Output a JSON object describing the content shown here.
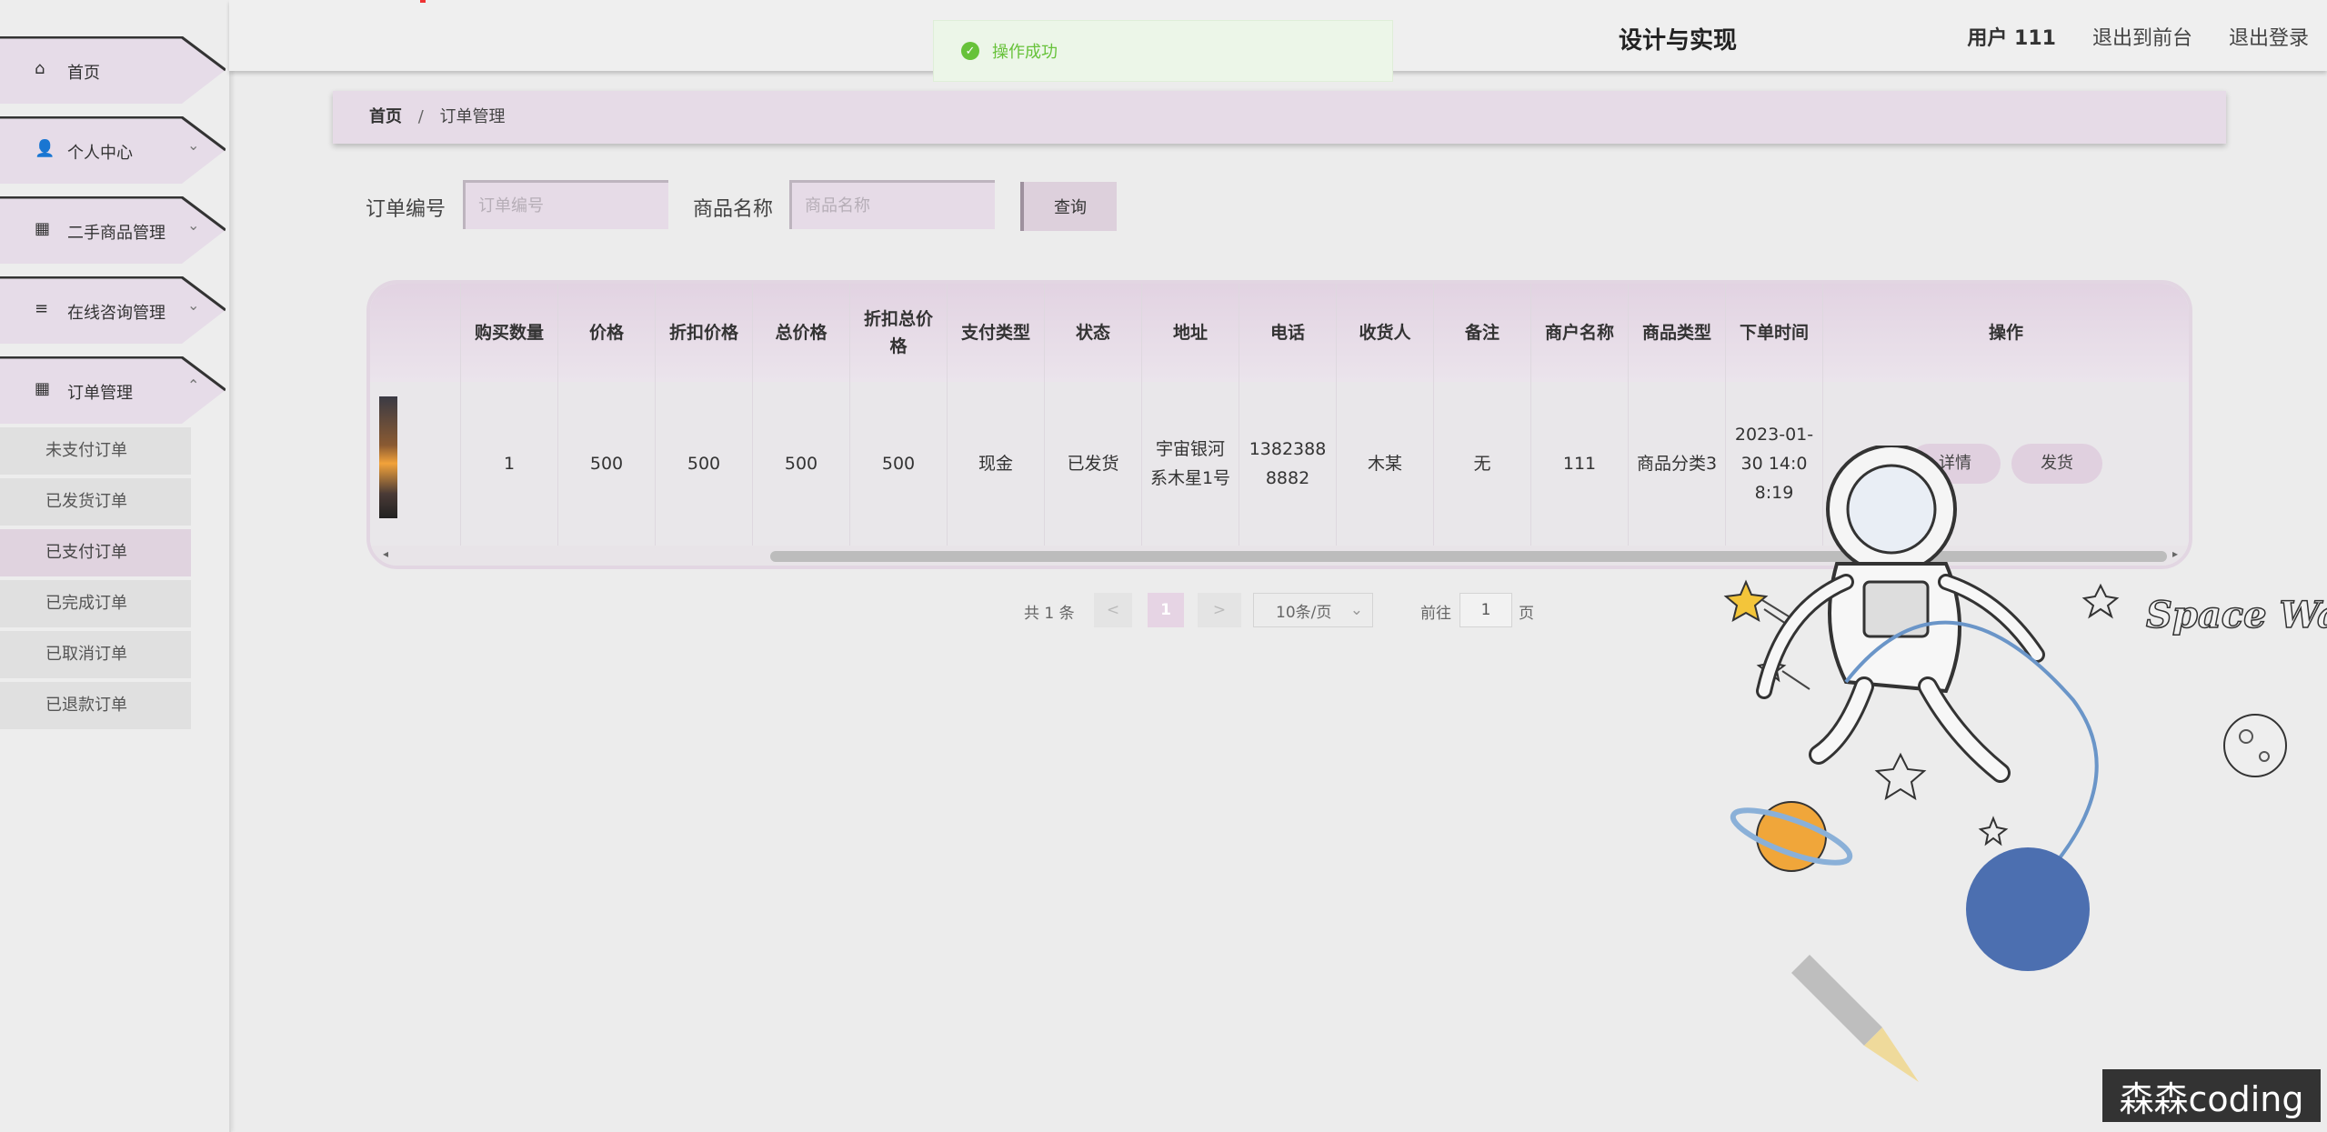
{
  "header": {
    "title_fragment": "设计与实现",
    "user": "用户 111",
    "to_front": "退出到前台",
    "logout": "退出登录"
  },
  "toast": {
    "message": "操作成功"
  },
  "sidebar": {
    "items": [
      {
        "label": "首页",
        "icon": "home-icon"
      },
      {
        "label": "个人中心",
        "icon": "user-icon"
      },
      {
        "label": "二手商品管理",
        "icon": "grid-icon"
      },
      {
        "label": "在线咨询管理",
        "icon": "list-icon"
      },
      {
        "label": "订单管理",
        "icon": "grid-icon"
      }
    ],
    "sub_items": [
      "未支付订单",
      "已发货订单",
      "已支付订单",
      "已完成订单",
      "已取消订单",
      "已退款订单"
    ],
    "active_sub": "已支付订单"
  },
  "breadcrumb": {
    "home": "首页",
    "sep": "/",
    "current": "订单管理"
  },
  "search": {
    "order_no_label": "订单编号",
    "order_no_placeholder": "订单编号",
    "product_label": "商品名称",
    "product_placeholder": "商品名称",
    "query_button": "查询"
  },
  "table": {
    "headers": [
      "购买数量",
      "价格",
      "折扣价格",
      "总价格",
      "折扣总价格",
      "支付类型",
      "状态",
      "地址",
      "电话",
      "收货人",
      "备注",
      "商户名称",
      "商品类型",
      "下单时间",
      "操作"
    ],
    "rows": [
      {
        "qty": "1",
        "price": "500",
        "discount_price": "500",
        "total": "500",
        "discount_total": "500",
        "pay_type": "现金",
        "status": "已发货",
        "address": "宇宙银河系木星1号",
        "phone": "13823888882",
        "receiver": "木某",
        "remark": "无",
        "merchant": "111",
        "product_type": "商品分类3",
        "order_time": "2023-01-30 14:08:19",
        "actions": [
          "详情",
          "发货"
        ]
      }
    ]
  },
  "pagination": {
    "total": "共 1 条",
    "prev": "<",
    "current_page": "1",
    "next": ">",
    "page_size": "10条/页",
    "goto_label": "前往",
    "goto_value": "1",
    "page_unit": "页"
  },
  "illustration": {
    "text": "Space Walk"
  },
  "watermark": "森森coding",
  "colors": {
    "accent": "#e6dbe7",
    "success": "#67c23a"
  }
}
